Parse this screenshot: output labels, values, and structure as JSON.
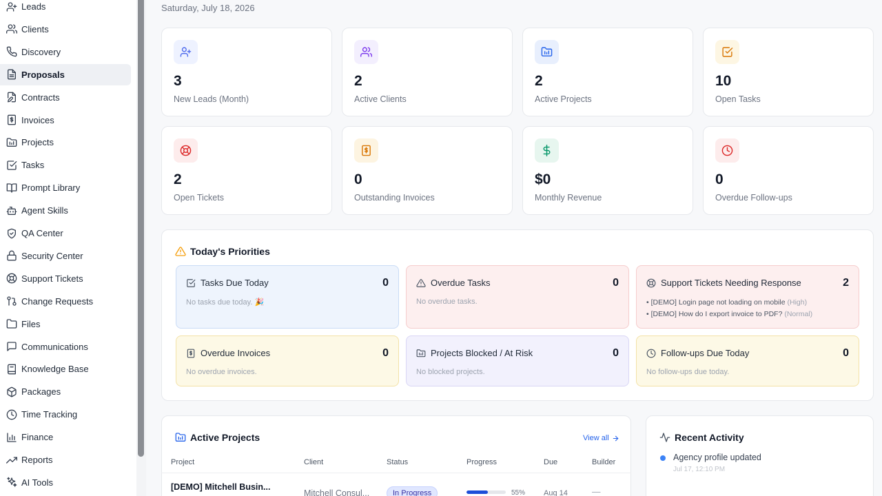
{
  "sidebar": {
    "items": [
      {
        "label": "Leads",
        "icon": "user-plus-icon",
        "active": false
      },
      {
        "label": "Clients",
        "icon": "users-icon",
        "active": false
      },
      {
        "label": "Discovery",
        "icon": "phone-icon",
        "active": false
      },
      {
        "label": "Proposals",
        "icon": "file-text-icon",
        "active": true
      },
      {
        "label": "Contracts",
        "icon": "file-edit-icon",
        "active": false
      },
      {
        "label": "Invoices",
        "icon": "invoice-dollar-icon",
        "active": false
      },
      {
        "label": "Projects",
        "icon": "folder-chart-icon",
        "active": false
      },
      {
        "label": "Tasks",
        "icon": "check-square-icon",
        "active": false
      },
      {
        "label": "Prompt Library",
        "icon": "book-open-icon",
        "active": false
      },
      {
        "label": "Agent Skills",
        "icon": "bot-icon",
        "active": false
      },
      {
        "label": "QA Center",
        "icon": "shield-check-icon",
        "active": false
      },
      {
        "label": "Security Center",
        "icon": "lock-icon",
        "active": false
      },
      {
        "label": "Support Tickets",
        "icon": "life-buoy-icon",
        "active": false
      },
      {
        "label": "Change Requests",
        "icon": "git-pull-request-icon",
        "active": false
      },
      {
        "label": "Files",
        "icon": "folder-open-icon",
        "active": false
      },
      {
        "label": "Communications",
        "icon": "message-square-icon",
        "active": false
      },
      {
        "label": "Knowledge Base",
        "icon": "book-icon",
        "active": false
      },
      {
        "label": "Packages",
        "icon": "package-icon",
        "active": false
      },
      {
        "label": "Time Tracking",
        "icon": "clock-icon",
        "active": false
      },
      {
        "label": "Finance",
        "icon": "bar-chart-icon",
        "active": false
      },
      {
        "label": "Reports",
        "icon": "trending-up-icon",
        "active": false
      },
      {
        "label": "AI Tools",
        "icon": "sparkles-icon",
        "active": false
      }
    ]
  },
  "header": {
    "date": "Saturday, July 18, 2026"
  },
  "stats": [
    {
      "value": "3",
      "label": "New Leads (Month)",
      "icon": "user-plus-icon",
      "color": "#4f6bed",
      "bg": "#eef2ff"
    },
    {
      "value": "2",
      "label": "Active Clients",
      "icon": "users-icon",
      "color": "#7c3aed",
      "bg": "#f3effe"
    },
    {
      "value": "2",
      "label": "Active Projects",
      "icon": "folder-chart-icon",
      "color": "#2563eb",
      "bg": "#e8effd"
    },
    {
      "value": "10",
      "label": "Open Tasks",
      "icon": "check-square-icon",
      "color": "#d97706",
      "bg": "#fdf6e3"
    },
    {
      "value": "2",
      "label": "Open Tickets",
      "icon": "life-buoy-icon",
      "color": "#dc2626",
      "bg": "#fdecec"
    },
    {
      "value": "0",
      "label": "Outstanding Invoices",
      "icon": "invoice-dollar-icon",
      "color": "#d97706",
      "bg": "#fdf4e1"
    },
    {
      "value": "$0",
      "label": "Monthly Revenue",
      "icon": "dollar-icon",
      "color": "#059669",
      "bg": "#e7f6ef"
    },
    {
      "value": "0",
      "label": "Overdue Follow-ups",
      "icon": "clock-icon",
      "color": "#dc2626",
      "bg": "#fdecec"
    }
  ],
  "priorities": {
    "title": "Today's Priorities",
    "cards": [
      {
        "title": "Tasks Due Today",
        "count": "0",
        "empty": "No tasks due today. 🎉",
        "icon": "check-square-icon",
        "bg": "#eef4fd",
        "border": "#c9dbf6"
      },
      {
        "title": "Overdue Tasks",
        "count": "0",
        "empty": "No overdue tasks.",
        "icon": "alert-triangle-icon",
        "bg": "#fdefef",
        "border": "#f5cccc"
      },
      {
        "title": "Support Tickets Needing Response",
        "count": "2",
        "empty": "",
        "icon": "life-buoy-icon",
        "bg": "#fdefef",
        "border": "#f5cccc",
        "items": [
          {
            "text": "• [DEMO] Login page not loading on mobile",
            "tag": "(High)"
          },
          {
            "text": "• [DEMO] How do I export invoice to PDF?",
            "tag": "(Normal)"
          }
        ]
      },
      {
        "title": "Overdue Invoices",
        "count": "0",
        "empty": "No overdue invoices.",
        "icon": "invoice-dollar-icon",
        "bg": "#fdf9e6",
        "border": "#f3e2a6"
      },
      {
        "title": "Projects Blocked / At Risk",
        "count": "0",
        "empty": "No blocked projects.",
        "icon": "folder-chart-icon",
        "bg": "#f2f1fd",
        "border": "#d9d6f5"
      },
      {
        "title": "Follow-ups Due Today",
        "count": "0",
        "empty": "No follow-ups due today.",
        "icon": "clock-icon",
        "bg": "#fdf9e6",
        "border": "#f3e2a6"
      }
    ]
  },
  "projects": {
    "title": "Active Projects",
    "view_all": "View all",
    "columns": [
      "Project",
      "Client",
      "Status",
      "Progress",
      "Due",
      "Builder"
    ],
    "rows": [
      {
        "project": "[DEMO] Mitchell Busin...",
        "client": "Mitchell Consul...",
        "status": "In Progress",
        "progress": 55,
        "progress_label": "55%",
        "due": "Aug 14",
        "builder": "—"
      }
    ]
  },
  "activity": {
    "title": "Recent Activity",
    "items": [
      {
        "text": "Agency profile updated",
        "time": "Jul 17, 12:10 PM"
      }
    ]
  }
}
